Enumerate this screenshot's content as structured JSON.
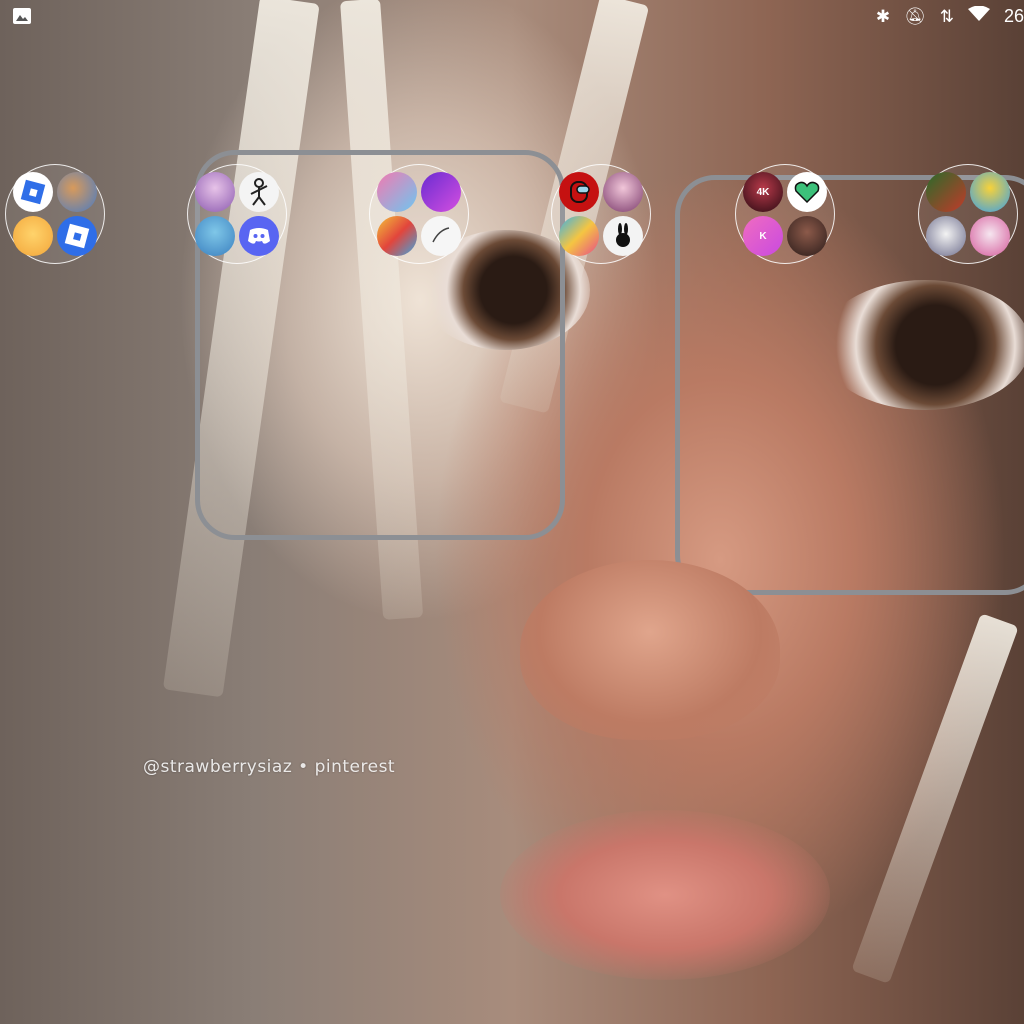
{
  "status_bar": {
    "left_icon": "image-icon",
    "icons": [
      "bluetooth-icon",
      "mute-icon",
      "data-arrows-icon",
      "wifi-icon"
    ],
    "time": "26"
  },
  "wallpaper": {
    "watermark": "@strawberrysiaz • pinterest"
  },
  "folders": [
    {
      "apps": [
        "roblox-icon",
        "bird-game-icon",
        "emoji-bear-icon",
        "roblox-icon"
      ]
    },
    {
      "apps": [
        "talking-cat-icon",
        "stickman-icon",
        "doll-game-icon",
        "discord-icon"
      ]
    },
    {
      "apps": [
        "art-game-icon",
        "purple-game-icon",
        "color-game-icon",
        "drawing-icon"
      ]
    },
    {
      "apps": [
        "among-us-icon",
        "avatar-game-icon",
        "puzzle-icon",
        "bunny-icon"
      ]
    },
    {
      "apps": [
        "4k-wallpaper-icon",
        "pixel-heart-icon",
        "k-app-icon",
        "group-photo-icon"
      ]
    },
    {
      "apps": [
        "jungle-game-icon",
        "colorful-game-icon",
        "cat-sticker-icon",
        "kuromi-icon"
      ]
    }
  ],
  "colors": {
    "folder_border": "#ffffff",
    "roblox_blue": "#2f6ee8",
    "discord_blurple": "#5865f2",
    "among_us_red": "#c51111"
  }
}
